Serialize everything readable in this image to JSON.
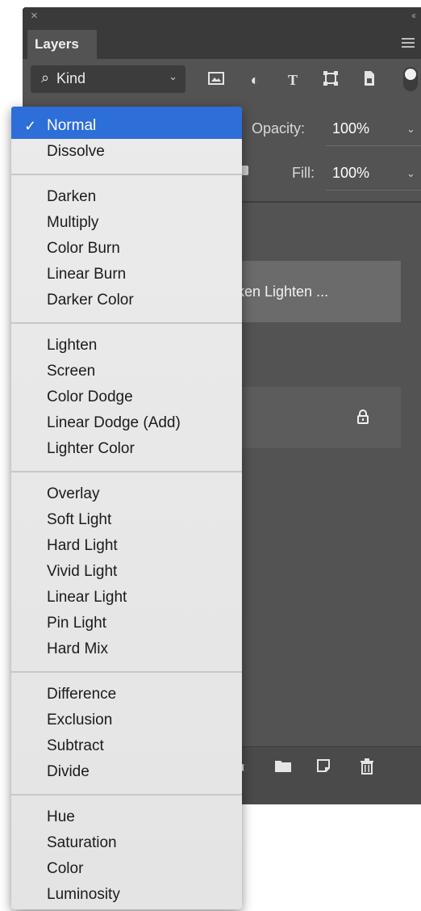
{
  "panel": {
    "close_glyph": "×",
    "collapse_glyph": "‹‹",
    "tab_label": "Layers",
    "kind_label": "Kind",
    "filter_icons": [
      "image-filter-icon",
      "adjustment-filter-icon",
      "type-filter-icon",
      "shape-filter-icon",
      "smart-object-filter-icon"
    ],
    "opacity_label": "Opacity:",
    "opacity_value": "100%",
    "fill_label": "Fill:",
    "fill_value": "100%",
    "selected_layer_text": "rken  Lighten ...",
    "footer_icons": [
      "adjustment-layer-icon",
      "folder-icon",
      "new-layer-icon",
      "trash-icon"
    ]
  },
  "menu": {
    "selected": "Normal",
    "groups": [
      [
        "Normal",
        "Dissolve"
      ],
      [
        "Darken",
        "Multiply",
        "Color Burn",
        "Linear Burn",
        "Darker Color"
      ],
      [
        "Lighten",
        "Screen",
        "Color Dodge",
        "Linear Dodge (Add)",
        "Lighter Color"
      ],
      [
        "Overlay",
        "Soft Light",
        "Hard Light",
        "Vivid Light",
        "Linear Light",
        "Pin Light",
        "Hard Mix"
      ],
      [
        "Difference",
        "Exclusion",
        "Subtract",
        "Divide"
      ],
      [
        "Hue",
        "Saturation",
        "Color",
        "Luminosity"
      ]
    ]
  },
  "colors": {
    "panel_bg": "#535353",
    "menu_bg": "#e8e8e8",
    "selection": "#2d6ed8"
  }
}
